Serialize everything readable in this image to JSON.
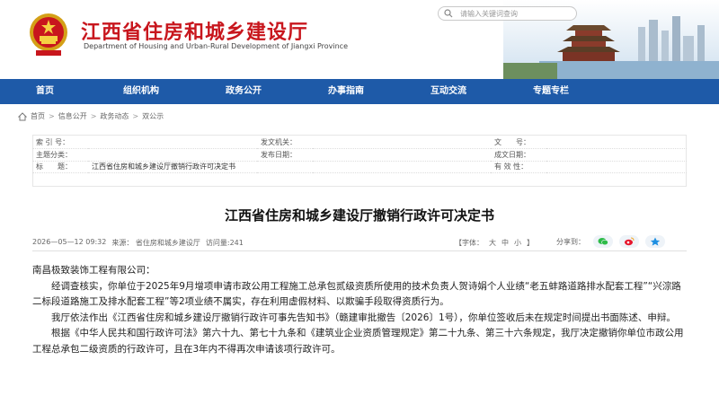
{
  "header": {
    "title": "江西省住房和城乡建设厅",
    "subtitle": "Department of Housing and Urban-Rural Development of Jiangxi Province",
    "search_placeholder": "请输入关键词查询"
  },
  "nav": {
    "items": [
      "首页",
      "组织机构",
      "政务公开",
      "办事指南",
      "互动交流",
      "专题专栏"
    ]
  },
  "breadcrumb": [
    "首页",
    "信息公开",
    "政务动态",
    "双公示"
  ],
  "info": {
    "index_label": "索 引 号：",
    "index_value": "",
    "issuer_label": "发文机关：",
    "issuer_value": "",
    "docno_label": "文　　号：",
    "docno_value": "",
    "topic_label": "主题分类：",
    "topic_value": "",
    "date_label": "发布日期：",
    "date_value": "",
    "created_label": "成文日期：",
    "created_value": "",
    "title_label": "标　　题：",
    "title_value": "江西省住房和城乡建设厅撤销行政许可决定书",
    "valid_label": "有 效 性：",
    "valid_value": ""
  },
  "article": {
    "title": "江西省住房和城乡建设厅撤销行政许可决定书",
    "datetime": "2026—05—12 09:32",
    "source": "来源：  省住房和城乡建设厅",
    "views": "访问量:241",
    "font_label": "【字体：",
    "font_large": "大",
    "font_medium": "中",
    "font_small": "小",
    "font_close": "】",
    "share_label": "分享到：",
    "recipient": "南昌极致装饰工程有限公司：",
    "para1": "经调查核实，你单位于2025年9月增项申请市政公用工程施工总承包贰级资质所使用的技术负责人贺诗娟个人业绩“老五蚌路道路排水配套工程”“兴淙路二标段道路施工及排水配套工程”等2项业绩不属实，存在利用虚假材料、以欺骗手段取得资质行为。",
    "para2": "我厅依法作出《江西省住房和城乡建设厅撤销行政许可事先告知书》（赣建审批撤告〔2026〕1号），你单位签收后未在规定时间提出书面陈述、申辩。",
    "para3": "根据《中华人民共和国行政许可法》第六十九、第七十九条和《建筑业企业资质管理规定》第二十九条、第三十六条规定，我厅决定撤销你单位市政公用工程总承包二级资质的行政许可，且在3年内不得再次申请该项行政许可。"
  },
  "colors": {
    "brand_red": "#c8161d",
    "nav_blue": "#1e5aa8"
  },
  "icons": [
    "national-emblem-icon",
    "search-icon",
    "home-icon",
    "wechat-icon",
    "weibo-icon",
    "qq-zone-icon"
  ]
}
